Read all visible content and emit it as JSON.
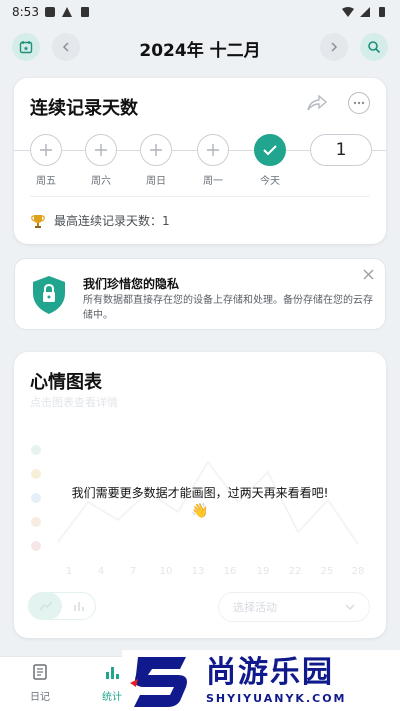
{
  "status_bar": {
    "time": "8:53"
  },
  "header": {
    "title": "2024年 十二月"
  },
  "streak": {
    "title": "连续记录天数",
    "days": [
      {
        "label": "周五",
        "done": false
      },
      {
        "label": "周六",
        "done": false
      },
      {
        "label": "周日",
        "done": false
      },
      {
        "label": "周一",
        "done": false
      },
      {
        "label": "今天",
        "done": true
      }
    ],
    "count": "1",
    "best": "最高连续记录天数：1"
  },
  "privacy": {
    "title": "我们珍惜您的隐私",
    "body": "所有数据都直接存在您的设备上存储和处理。备份存储在您的云存储中。"
  },
  "mood": {
    "title": "心情图表",
    "subtitle": "点击图表查看详情",
    "message": "我们需要更多数据才能画图，过两天再来看看吧!",
    "emoji": "👋",
    "x_ticks": [
      "1",
      "4",
      "7",
      "10",
      "13",
      "16",
      "19",
      "22",
      "25",
      "28"
    ],
    "activity_placeholder": "选择活动"
  },
  "nav": {
    "items": [
      {
        "label": "日记"
      },
      {
        "label": "统计"
      }
    ]
  },
  "watermark": {
    "cn": "尚游乐园",
    "en": "SHYIYUANYK.COM"
  },
  "colors": {
    "accent": "#22a58e",
    "brand": "#101a8c",
    "background": "#eef1f4"
  }
}
